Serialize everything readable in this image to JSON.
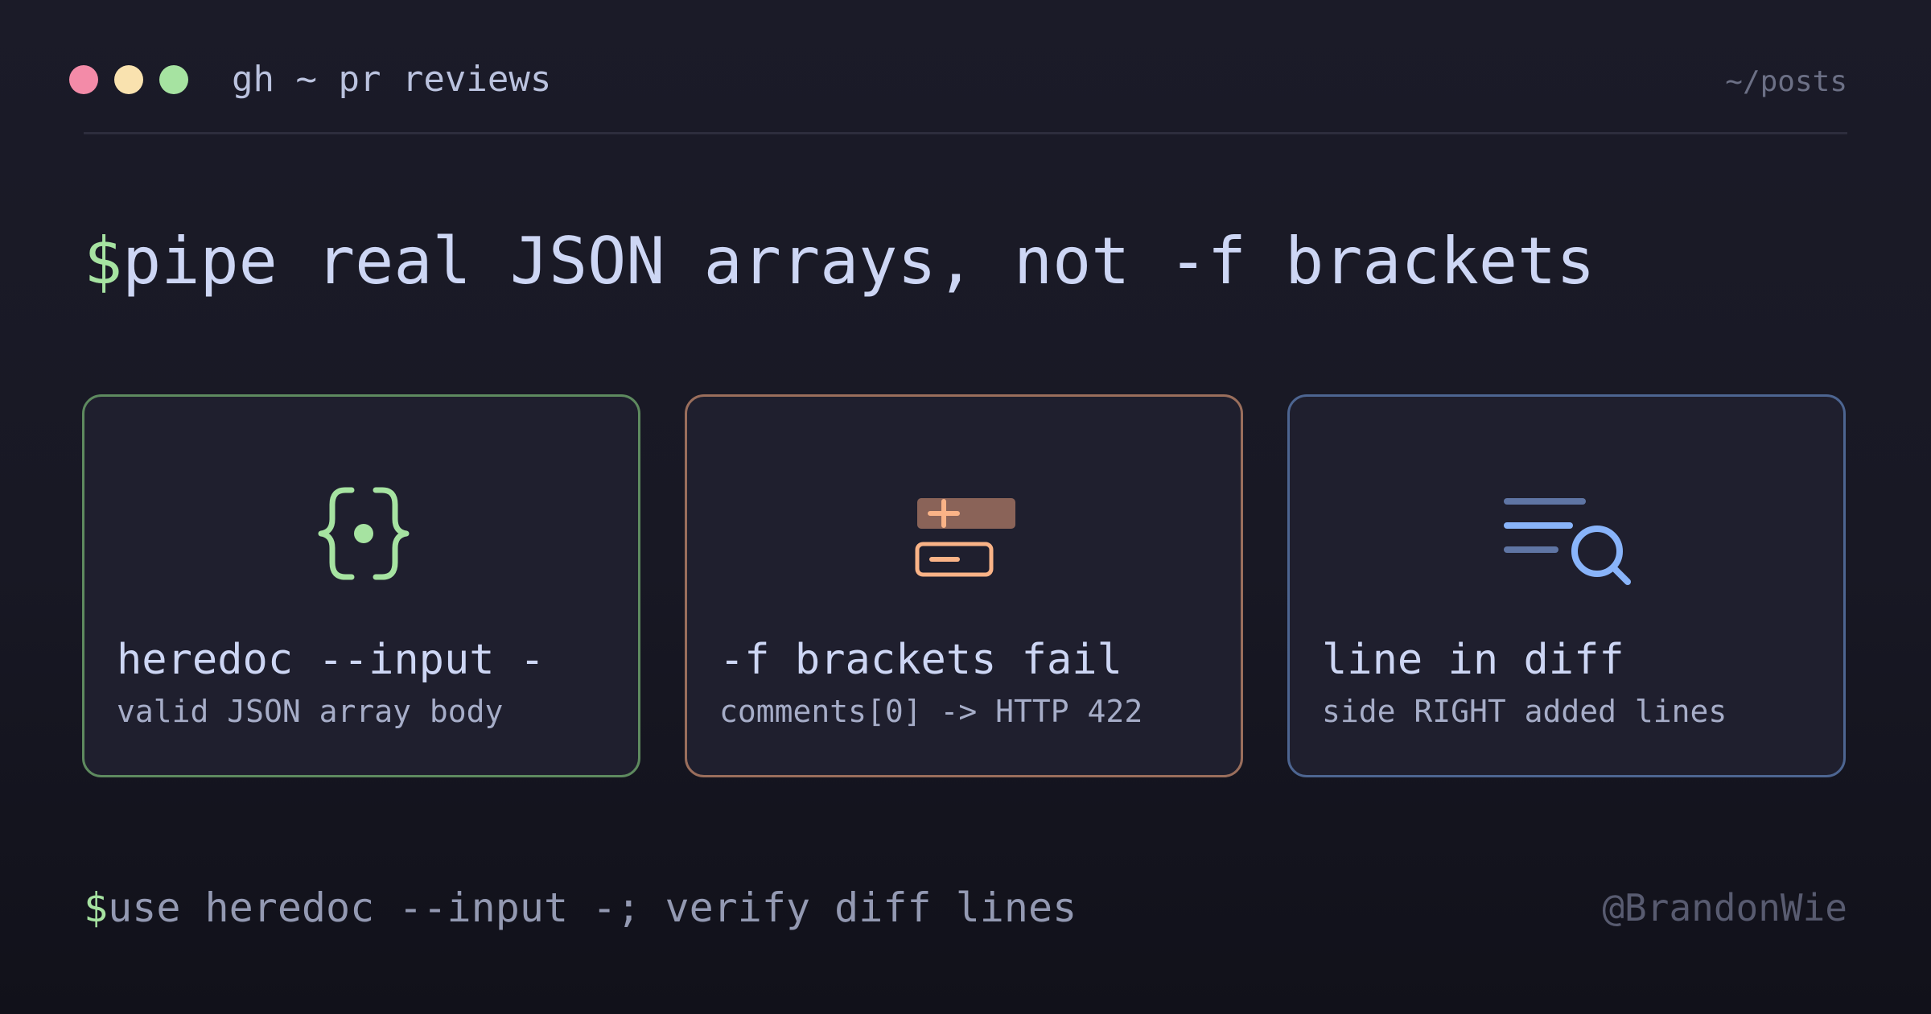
{
  "window": {
    "title": "gh ~ pr reviews",
    "path": "~/posts",
    "controls": [
      {
        "name": "close",
        "color": "#f38ba8"
      },
      {
        "name": "minimize",
        "color": "#f9e2af"
      },
      {
        "name": "maximize",
        "color": "#a6e3a1"
      }
    ]
  },
  "headline": {
    "prompt": "$",
    "text": "pipe real JSON arrays, not -f brackets"
  },
  "cards": [
    {
      "icon": "curly-braces-icon",
      "title": "heredoc --input -",
      "subtitle": "valid JSON array body",
      "accent": "#a6e3a1"
    },
    {
      "icon": "diff-plus-minus-icon",
      "title": "-f brackets fail",
      "subtitle": "comments[0] -> HTTP 422",
      "accent": "#fab387"
    },
    {
      "icon": "search-lines-icon",
      "title": "line in diff",
      "subtitle": "side RIGHT added lines",
      "accent": "#89b4fa"
    }
  ],
  "footer": {
    "prompt": "$",
    "text": "use heredoc --input -; verify diff lines",
    "handle": "@BrandonWie"
  }
}
